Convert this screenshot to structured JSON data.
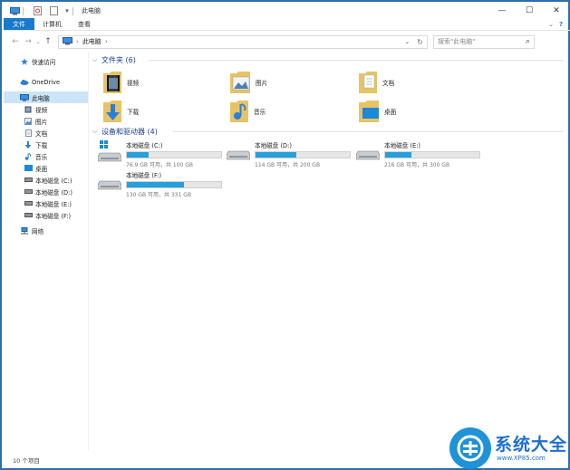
{
  "window": {
    "title": "此电脑",
    "minimize": "—",
    "maximize": "☐",
    "close": "✕"
  },
  "ribbon": {
    "tabs": [
      "文件",
      "计算机",
      "查看"
    ],
    "expand": "⌄",
    "help": "?"
  },
  "address": {
    "back": "←",
    "forward": "→",
    "recent": "⌄",
    "up": "↑",
    "path": "此电脑",
    "sep": "›",
    "dropdown": "⌄",
    "refresh": "↻",
    "search_placeholder": "搜索\"此电脑\"",
    "search_icon": "⌕"
  },
  "nav": {
    "items": [
      {
        "label": "快速访问",
        "icon": "star-icon"
      },
      {
        "label": "OneDrive",
        "icon": "cloud-icon"
      },
      {
        "label": "此电脑",
        "icon": "computer-icon",
        "selected": true
      },
      {
        "label": "视频",
        "icon": "video-icon"
      },
      {
        "label": "图片",
        "icon": "picture-icon"
      },
      {
        "label": "文档",
        "icon": "document-icon"
      },
      {
        "label": "下载",
        "icon": "download-icon"
      },
      {
        "label": "音乐",
        "icon": "music-icon"
      },
      {
        "label": "桌面",
        "icon": "desktop-icon"
      },
      {
        "label": "本地磁盘 (C:)",
        "icon": "drive-icon"
      },
      {
        "label": "本地磁盘 (D:)",
        "icon": "drive-icon"
      },
      {
        "label": "本地磁盘 (E:)",
        "icon": "drive-icon"
      },
      {
        "label": "本地磁盘 (F:)",
        "icon": "drive-icon"
      },
      {
        "label": "网络",
        "icon": "network-icon"
      }
    ]
  },
  "folders_group": {
    "title": "文件夹 (6)",
    "chevron": "⌵"
  },
  "folders": [
    {
      "label": "视频",
      "icon": "video-folder-icon"
    },
    {
      "label": "图片",
      "icon": "picture-folder-icon"
    },
    {
      "label": "文档",
      "icon": "document-folder-icon"
    },
    {
      "label": "下载",
      "icon": "download-folder-icon"
    },
    {
      "label": "音乐",
      "icon": "music-folder-icon"
    },
    {
      "label": "桌面",
      "icon": "desktop-folder-icon"
    }
  ],
  "drives_group": {
    "title": "设备和驱动器 (4)",
    "chevron": "⌵"
  },
  "drives": [
    {
      "name": "本地磁盘 (C:)",
      "free": "76.9 GB 可用，共 100 GB",
      "used_fraction": 0.231
    },
    {
      "name": "本地磁盘 (D:)",
      "free": "114 GB 可用，共 200 GB",
      "used_fraction": 0.43
    },
    {
      "name": "本地磁盘 (E:)",
      "free": "216 GB 可用，共 300 GB",
      "used_fraction": 0.28
    },
    {
      "name": "本地磁盘 (F:)",
      "free": "130 GB 可用，共 331 GB",
      "used_fraction": 0.607
    }
  ],
  "status": {
    "count": "10 个项目"
  },
  "watermark": {
    "main": "系统大全",
    "sub": "www.XP85.com"
  },
  "colors": {
    "accent": "#1979ca",
    "bar_fill": "#26a0da",
    "group_title": "#1e3f8a"
  }
}
